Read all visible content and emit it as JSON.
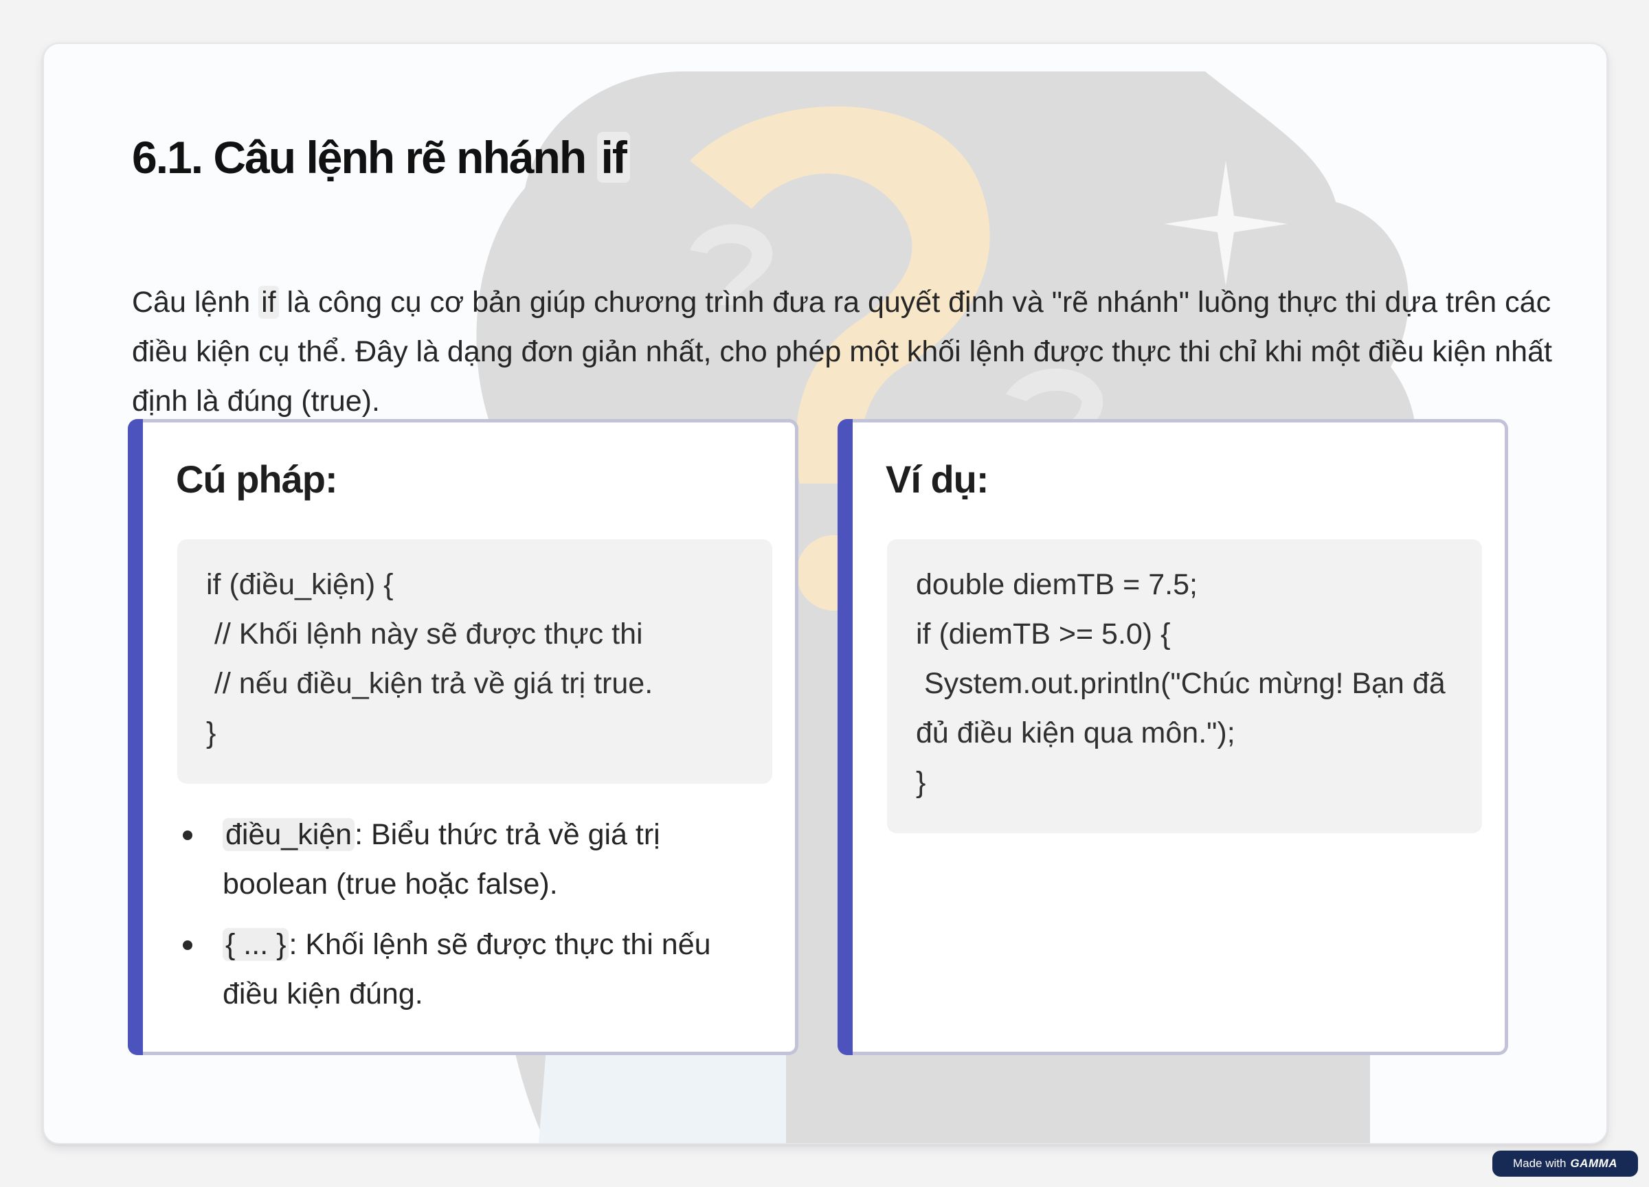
{
  "slide": {
    "title_prefix": "6.1. Câu lệnh rẽ nhánh ",
    "title_code": "if",
    "intro": {
      "before": "Câu lệnh ",
      "code": "if",
      "after": " là công cụ cơ bản giúp chương trình đưa ra quyết định và \"rẽ nhánh\" luồng thực thi dựa trên các điều kiện cụ thể. Đây là dạng đơn giản nhất, cho phép một khối lệnh được thực thi chỉ khi một điều kiện nhất định là đúng (true)."
    }
  },
  "syntax_card": {
    "title": "Cú pháp:",
    "code_lines": [
      "if (điều_kiện) {",
      " // Khối lệnh này sẽ được thực thi",
      " // nếu điều_kiện trả về giá trị true.",
      "}"
    ],
    "bullets": [
      {
        "code": "điều_kiện",
        "text": ": Biểu thức trả về giá trị boolean (true hoặc false)."
      },
      {
        "code": "{ ... }",
        "text": ": Khối lệnh sẽ được thực thi nếu điều kiện đúng."
      }
    ]
  },
  "example_card": {
    "title": "Ví dụ:",
    "code_lines": [
      "double diemTB = 7.5;",
      "if (diemTB >= 5.0) {",
      " System.out.println(\"Chúc mừng! Bạn đã đủ điều kiện qua môn.\");",
      "}"
    ]
  },
  "badge": {
    "made_with": "Made with",
    "brand": "GAMMA"
  },
  "colors": {
    "accent_bar": "#4c53bd",
    "card_border": "#c2c2d8",
    "code_background": "#f2f2f2",
    "badge_background": "#172a55"
  },
  "illustration": {
    "icons": [
      "question-mark-icon",
      "sparkle-icon",
      "thought-cloud"
    ]
  }
}
